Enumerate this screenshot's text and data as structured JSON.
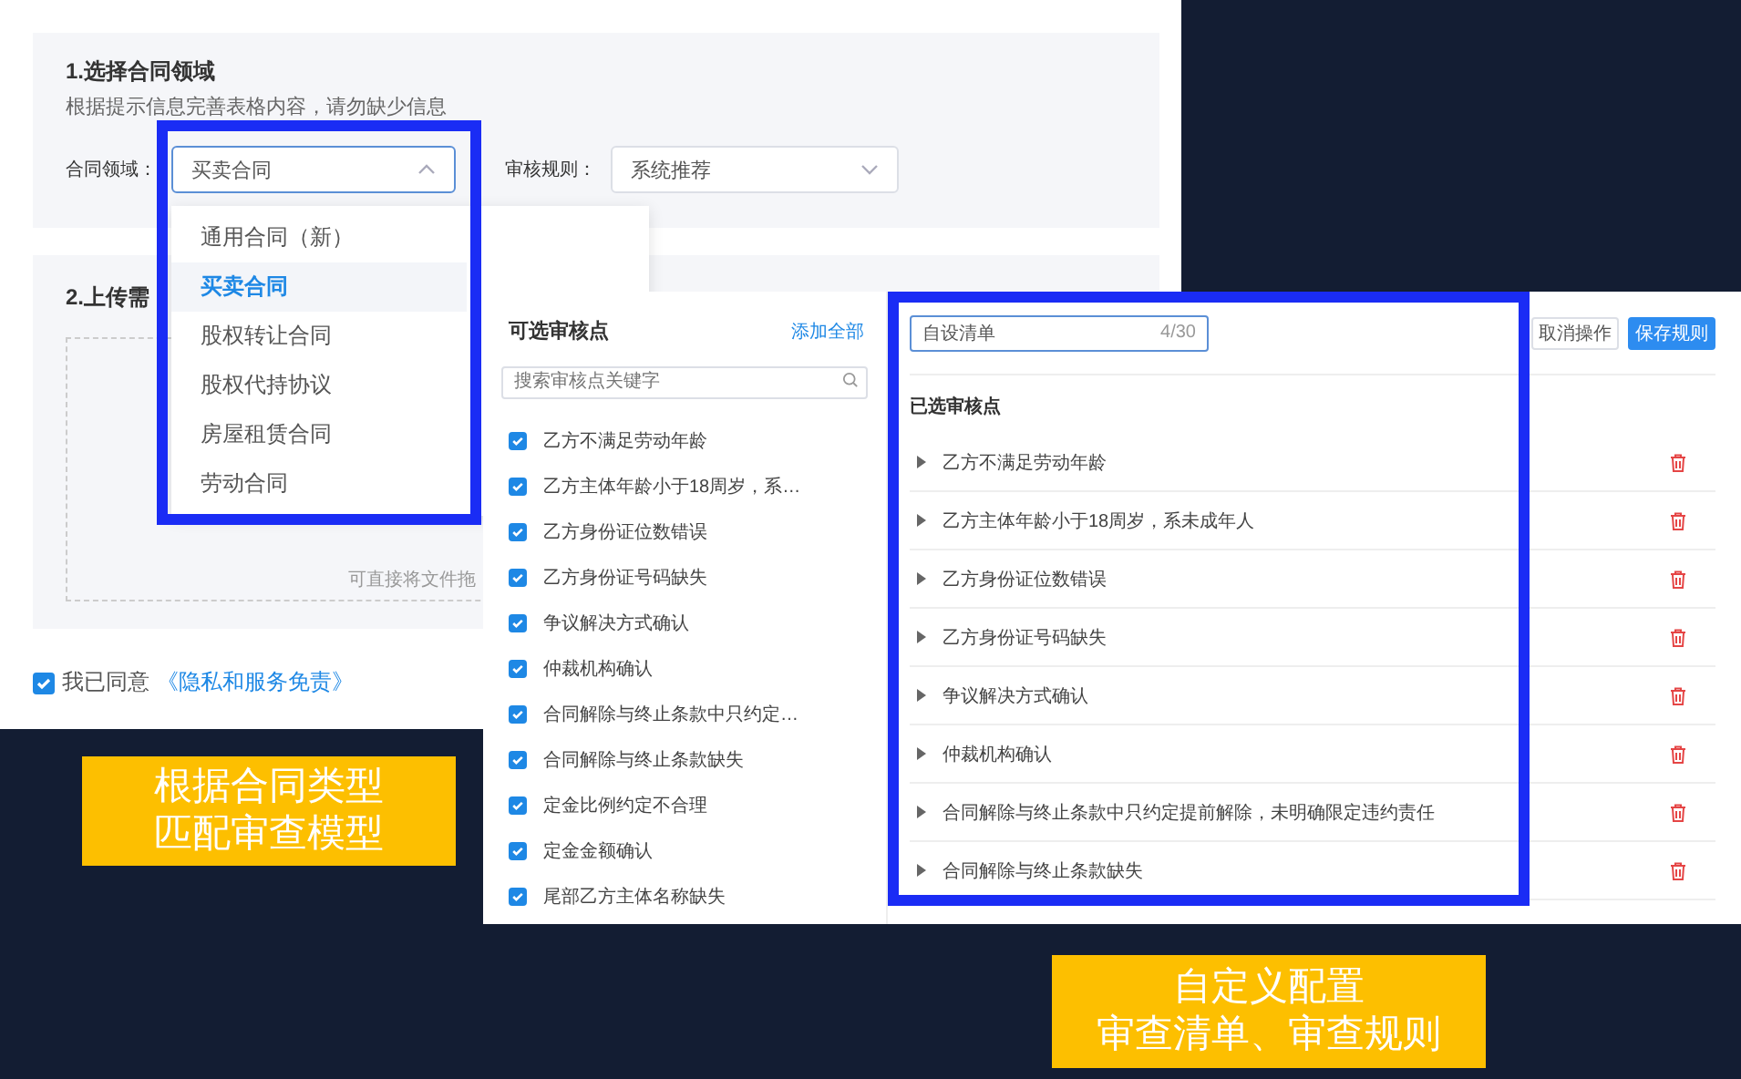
{
  "form_screen": {
    "section1": {
      "title": "1.选择合同领域",
      "hint": "根据提示信息完善表格内容，请勿缺少信息",
      "fields": [
        {
          "label": "合同领域：",
          "value": "买卖合同",
          "expanded": true
        },
        {
          "label": "审核规则：",
          "value": "系统推荐",
          "expanded": false
        }
      ]
    },
    "dropdown": {
      "items": [
        {
          "label": "通用合同（新）",
          "selected": false
        },
        {
          "label": "买卖合同",
          "selected": true
        },
        {
          "label": "股权转让合同",
          "selected": false
        },
        {
          "label": "股权代持协议",
          "selected": false
        },
        {
          "label": "房屋租赁合同",
          "selected": false
        },
        {
          "label": "劳动合同",
          "selected": false
        }
      ]
    },
    "section2": {
      "title": "2.上传需",
      "upload_hint": "可直接将文件拖"
    },
    "agreement": {
      "checked": true,
      "text": "我已同意",
      "link": "《隐私和服务免责》"
    }
  },
  "rules_screen": {
    "available": {
      "title": "可选审核点",
      "add_all": "添加全部",
      "search": {
        "placeholder": "搜索审核点关键字"
      },
      "items": [
        {
          "label": "乙方不满足劳动年龄",
          "checked": true
        },
        {
          "label": "乙方主体年龄小于18周岁，系…",
          "checked": true
        },
        {
          "label": "乙方身份证位数错误",
          "checked": true
        },
        {
          "label": "乙方身份证号码缺失",
          "checked": true
        },
        {
          "label": "争议解决方式确认",
          "checked": true
        },
        {
          "label": "仲裁机构确认",
          "checked": true
        },
        {
          "label": "合同解除与终止条款中只约定…",
          "checked": true
        },
        {
          "label": "合同解除与终止条款缺失",
          "checked": true
        },
        {
          "label": "定金比例约定不合理",
          "checked": true
        },
        {
          "label": "定金金额确认",
          "checked": true
        },
        {
          "label": "尾部乙方主体名称缺失",
          "checked": true
        }
      ]
    },
    "custom": {
      "name_input": {
        "value": "自设清单",
        "counter": "4/30"
      },
      "cancel": "取消操作",
      "save": "保存规则",
      "selected_title": "已选审核点",
      "items": [
        "乙方不满足劳动年龄",
        "乙方主体年龄小于18周岁，系未成年人",
        "乙方身份证位数错误",
        "乙方身份证号码缺失",
        "争议解决方式确认",
        "仲裁机构确认",
        "合同解除与终止条款中只约定提前解除，未明确限定违约责任",
        "合同解除与终止条款缺失"
      ]
    }
  },
  "captions": [
    {
      "lines": [
        "根据合同类型",
        "匹配审查模型"
      ]
    },
    {
      "lines": [
        "自定义配置",
        "审查清单、审查规则"
      ]
    }
  ]
}
